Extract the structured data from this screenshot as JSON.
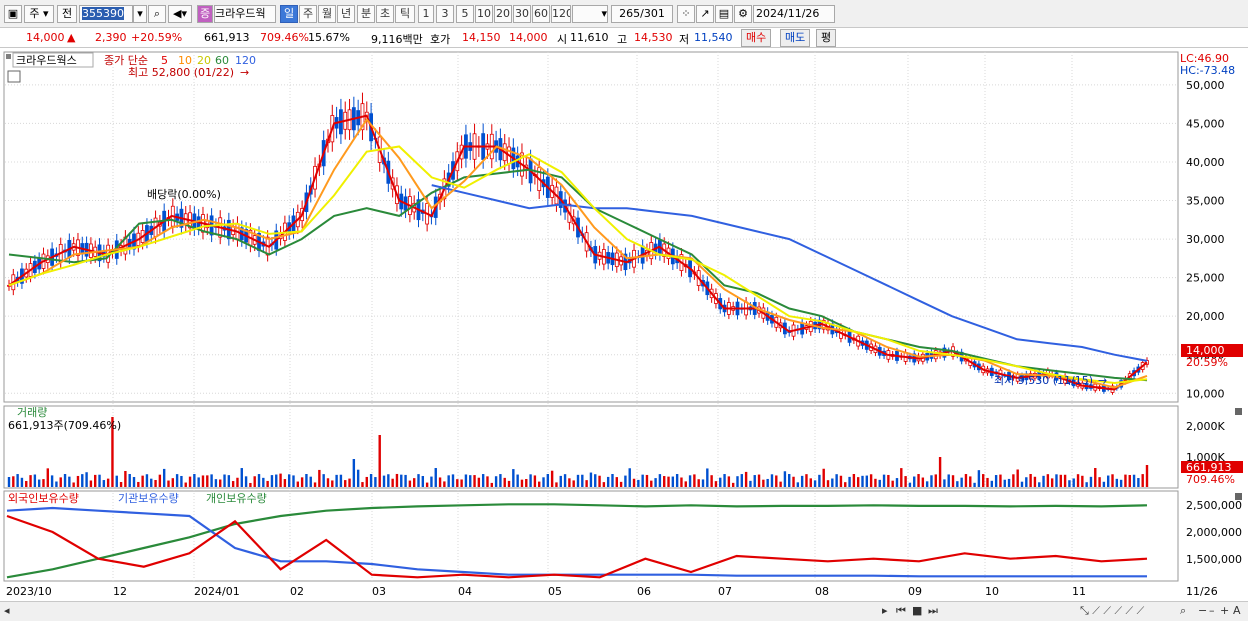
{
  "toolbar": {
    "type_select": "주",
    "prev_label": "전",
    "code": "355390",
    "sound_label": "◀",
    "badge": "증",
    "name": "크라우드웍",
    "periods": [
      "일",
      "주",
      "월",
      "년",
      "분",
      "초",
      "틱"
    ],
    "active_period": "일",
    "minutes": [
      "1",
      "3",
      "5",
      "10",
      "20",
      "30",
      "60",
      "120"
    ],
    "count_current": "265",
    "count_total": "/301",
    "date": "2024/11/26"
  },
  "quote": {
    "price": "14,000",
    "arrow": "▲",
    "change": "2,390",
    "change_pct": "+20.59%",
    "volume": "661,913",
    "volume_pct": "709.46%",
    "turnover": "15.67%",
    "amount": "9,116백만",
    "ask_label": "호가",
    "ask1": "14,150",
    "ask2": "14,000",
    "open_label": "시",
    "open": "11,610",
    "high_label": "고",
    "high": "14,530",
    "low_label": "저",
    "low": "11,540",
    "buy_label": "매수",
    "sell_label": "매도",
    "avg_label": "평"
  },
  "price_panel": {
    "stock_name": "크라우드웍스",
    "ma_title": "종가 단순",
    "ma_periods": [
      "5",
      "10",
      "20",
      "60",
      "120"
    ],
    "ma_colors": [
      "#e00000",
      "#ff9a1e",
      "#f0f000",
      "#2a8a3a",
      "#3060e0"
    ],
    "high_note": "최고 52,800 (01/22)",
    "dividend_note": "배당락(0.00%)",
    "low_note": "최저 9,530 (11/15)",
    "lc": "LC:46.90",
    "hc": "HC:-73.48",
    "y_ticks": [
      "50,000",
      "45,000",
      "40,000",
      "35,000",
      "30,000",
      "25,000",
      "20,000",
      "15,000",
      "10,000"
    ],
    "current_tag": "14,000",
    "pct_tag": "20.59%"
  },
  "volume_panel": {
    "title": "거래량",
    "value": "661,913주(709.46%)",
    "y_tick": "2,000K",
    "y_tick2": "1,000K",
    "current_tag": "661,913",
    "pct_tag": "709.46%"
  },
  "holding_panel": {
    "legend": [
      "외국인보유수량",
      "기관보유수량",
      "개인보유수량"
    ],
    "legend_colors": [
      "#e00000",
      "#3060e0",
      "#2a8a3a"
    ],
    "y_ticks": [
      "2,500,000",
      "2,000,000",
      "1,500,000"
    ]
  },
  "x_axis": [
    "2023/10",
    "12",
    "2024/01",
    "02",
    "03",
    "04",
    "05",
    "06",
    "07",
    "08",
    "09",
    "10",
    "11",
    "11/26"
  ],
  "chart_data": {
    "type": "line",
    "series": [
      {
        "name": "5",
        "values": [
          24000,
          27000,
          29000,
          28000,
          30000,
          33000,
          32000,
          31000,
          29000,
          33000,
          45000,
          46000,
          35000,
          33000,
          42000,
          42000,
          39000,
          35000,
          28000,
          27000,
          29000,
          26000,
          21000,
          21000,
          18000,
          19000,
          17000,
          15000,
          14500,
          15500,
          13000,
          12000,
          12500,
          11000,
          10500,
          14000
        ]
      },
      {
        "name": "60",
        "values": [
          28000,
          27500,
          27000,
          27500,
          32000,
          32500,
          31000,
          30000,
          28000,
          30000,
          33000,
          34000,
          33000,
          36000,
          38000,
          38500,
          39000,
          38000,
          34000,
          32000,
          30000,
          28000,
          24000,
          23000,
          21000,
          20000,
          18000,
          17000,
          16000,
          15500,
          14500,
          13500,
          13000,
          12500,
          12000,
          11700
        ]
      },
      {
        "name": "120",
        "values": [
          null,
          null,
          null,
          null,
          null,
          null,
          null,
          null,
          null,
          null,
          null,
          null,
          null,
          37000,
          36000,
          35000,
          34000,
          34500,
          34000,
          34000,
          33500,
          33000,
          32000,
          31000,
          30000,
          28000,
          26000,
          24000,
          22000,
          20000,
          18500,
          17000,
          16500,
          16000,
          15000,
          14200
        ]
      }
    ],
    "ylim": [
      9000,
      54000
    ],
    "holdings": {
      "foreign": [
        2300000,
        2000000,
        1500000,
        1350000,
        1600000,
        2200000,
        1300000,
        1850000,
        1200000,
        1150000,
        1200000,
        1150000,
        1200000,
        1150000,
        1500000,
        1250000,
        1550000,
        1500000,
        1450000,
        1500000,
        1450000,
        1600000,
        1500000,
        1550000,
        1450000,
        1500000
      ],
      "institution": [
        2400000,
        2450000,
        2400000,
        2350000,
        2300000,
        1700000,
        1450000,
        1450000,
        1400000,
        1300000,
        1250000,
        1200000,
        1200000,
        1200000,
        1200000,
        1200000,
        1180000,
        1180000,
        1180000,
        1180000,
        1170000,
        1170000,
        1170000,
        1170000,
        1170000,
        1170000
      ],
      "individual": [
        1150000,
        1300000,
        1500000,
        1700000,
        1900000,
        2150000,
        2300000,
        2400000,
        2450000,
        2480000,
        2500000,
        2520000,
        2520000,
        2500000,
        2480000,
        2500000,
        2480000,
        2490000,
        2490000,
        2500000,
        2490000,
        2490000,
        2480000,
        2490000,
        2480000,
        2500000
      ],
      "ylim": [
        1100000,
        2600000
      ]
    }
  }
}
